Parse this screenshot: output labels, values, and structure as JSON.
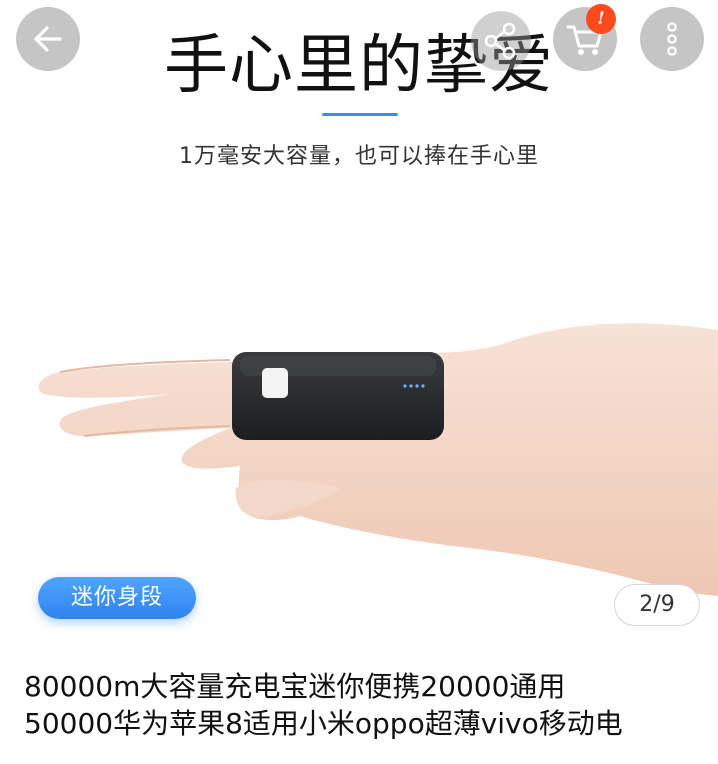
{
  "topbar": {
    "back_icon": "arrow-left-icon",
    "share_icon": "share-icon",
    "cart_icon": "cart-icon",
    "cart_badge": "!",
    "more_icon": "more-vertical-icon"
  },
  "hero": {
    "headline": "手心里的挚爱",
    "subline": "1万毫安大容量，也可以捧在手心里",
    "badge": "迷你身段",
    "counter": "2/9",
    "accent_color": "#3d8fe6"
  },
  "product": {
    "title_line1": "80000m大容量充电宝迷你便携20000通用",
    "title_line2": "50000华为苹果8适用小米oppo超薄vivo移动电"
  }
}
